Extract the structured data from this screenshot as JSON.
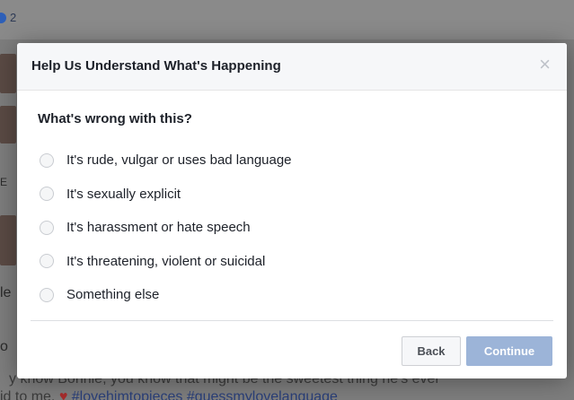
{
  "background": {
    "reaction_count": "2",
    "side_letter_1": "E",
    "side_letter_2": "le",
    "side_letter_3": "o",
    "partial_line_1": "y   know Bonnie, you know that might be the sweetest thing he's ever",
    "partial_line_2": "id to me.",
    "heart_icon": "heart-icon",
    "partial_tags": "#lovehimtopieces #guessmylovelanguage"
  },
  "dialog": {
    "title": "Help Us Understand What's Happening",
    "close_glyph": "×",
    "question": "What's wrong with this?",
    "options": [
      "It's rude, vulgar or uses bad language",
      "It's sexually explicit",
      "It's harassment or hate speech",
      "It's threatening, violent or suicidal",
      "Something else"
    ],
    "back_label": "Back",
    "continue_label": "Continue"
  },
  "colors": {
    "continue_disabled": "#9cb4d8",
    "header_bg": "#f6f7f9",
    "reaction": "#2d5fb8"
  }
}
